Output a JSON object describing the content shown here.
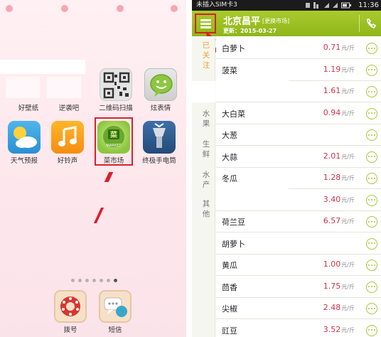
{
  "launcher": {
    "apps": [
      {
        "label": "好壁纸",
        "icon": "wallpaper-icon"
      },
      {
        "label": "逆袭吧",
        "icon": "game-icon"
      },
      {
        "label": "二维码扫描",
        "icon": "qr-code-icon"
      },
      {
        "label": "炫表情",
        "icon": "emoji-chat-icon"
      },
      {
        "label": "天气预报",
        "icon": "weather-icon"
      },
      {
        "label": "好铃声",
        "icon": "music-note-icon"
      },
      {
        "label": "菜市场",
        "icon": "vegetable-market-icon",
        "logo_text": "MARKET"
      },
      {
        "label": "终极手电筒",
        "icon": "flashlight-icon"
      }
    ],
    "dock": [
      {
        "label": "拨号",
        "icon": "phone-dial-icon"
      },
      {
        "label": "短信",
        "icon": "sms-bubble-icon"
      }
    ],
    "page_indicator": {
      "pages": 7,
      "current": 7
    },
    "accent_color": "#d9202a"
  },
  "statusbar": {
    "carrier": "未插入SIM卡3",
    "time": "11:36"
  },
  "header": {
    "city": "北京昌平",
    "switch_market": "[更换市场]",
    "updated": "更新：2015-03-27",
    "brand_color": "#9dc122"
  },
  "sidebar": {
    "categories": [
      {
        "label": "已关注",
        "lines": [
          "已",
          "关",
          "注"
        ],
        "active": true
      },
      {
        "label": "水果",
        "lines": [
          "水",
          "果"
        ],
        "active": false
      },
      {
        "label": "生鲜",
        "lines": [
          "生",
          "鲜"
        ],
        "active": false
      },
      {
        "label": "水产",
        "lines": [
          "水",
          "产"
        ],
        "active": false
      },
      {
        "label": "其他",
        "lines": [
          "其",
          "他"
        ],
        "active": false
      }
    ]
  },
  "unit": "元/斤",
  "products": [
    {
      "name": "白萝卜",
      "price": "0.71"
    },
    {
      "name": "菠菜",
      "price": "1.19"
    },
    {
      "name": "",
      "price": "1.61"
    },
    {
      "name": "大白菜",
      "price": "0.94"
    },
    {
      "name": "大葱",
      "price": ""
    },
    {
      "name": "大蒜",
      "price": "2.01"
    },
    {
      "name": "冬瓜",
      "price": "1.28"
    },
    {
      "name": "",
      "price": "3.40"
    },
    {
      "name": "荷兰豆",
      "price": "6.57"
    },
    {
      "name": "胡萝卜",
      "price": ""
    },
    {
      "name": "黄瓜",
      "price": "1.00"
    },
    {
      "name": "茴香",
      "price": "1.75"
    },
    {
      "name": "尖椒",
      "price": "2.48"
    },
    {
      "name": "豇豆",
      "price": "3.52"
    }
  ]
}
